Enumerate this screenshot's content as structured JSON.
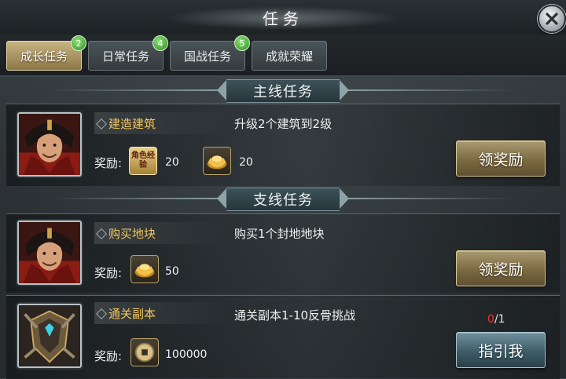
{
  "window": {
    "title": "任务"
  },
  "tabs": [
    {
      "label": "成长任务",
      "badge": "2",
      "active": true
    },
    {
      "label": "日常任务",
      "badge": "4",
      "active": false
    },
    {
      "label": "国战任务",
      "badge": "5",
      "active": false
    },
    {
      "label": "成就荣耀",
      "badge": "",
      "active": false
    }
  ],
  "sections": {
    "main": "主线任务",
    "side": "支线任务"
  },
  "reward_label": "奖励:",
  "quests": [
    {
      "name": "建造建筑",
      "description": "升级2个建筑到2级",
      "portrait_icon": "warrior-portrait-icon",
      "rewards": [
        {
          "icon": "role-exp-icon",
          "icon_text": "角色经验",
          "value": "20"
        },
        {
          "icon": "gold-ingot-icon",
          "value": "20"
        }
      ],
      "button": "领奖励"
    },
    {
      "name": "购买地块",
      "description": "购买1个封地地块",
      "portrait_icon": "warrior-portrait-icon",
      "rewards": [
        {
          "icon": "gold-ingot-icon",
          "value": "50"
        }
      ],
      "button": "领奖励"
    },
    {
      "name": "通关副本",
      "description": "通关副本1-10反骨挑战",
      "portrait_icon": "armor-crest-icon",
      "progress_current": "0",
      "progress_total": "/1",
      "rewards": [
        {
          "icon": "copper-coin-icon",
          "value": "100000"
        }
      ],
      "button": "指引我"
    }
  ],
  "colors": {
    "quest_name": "#f2c55c",
    "progress_current": "#ff2d2d",
    "badge": "#3fa52e",
    "active_tab": "#b39f6c"
  }
}
